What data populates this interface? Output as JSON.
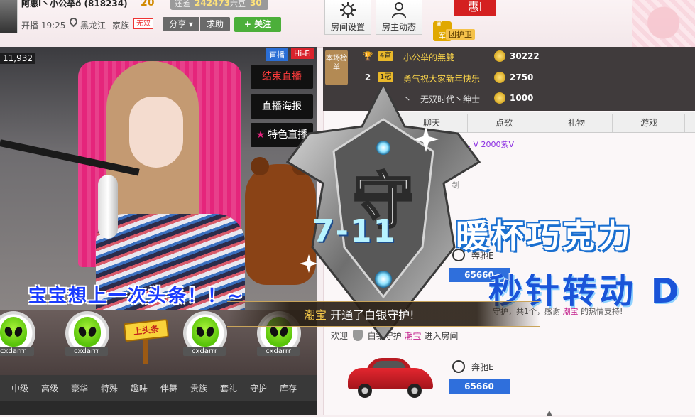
{
  "header": {
    "anchor_name": "阿惠i丶小公举ô (818234)",
    "level_value": "20",
    "diff_label": "还差",
    "diff_value": "242473",
    "bean_label": "六豆",
    "bean_level": "30",
    "live_time": "开播 19:25",
    "location": "黑龙江",
    "family_label": "家族",
    "family_value": "无双",
    "share_label": "分享",
    "help_label": "求助",
    "follow_label": "+ 关注",
    "room_settings_label": "房间设置",
    "owner_news_label": "房主动态",
    "hui_text": "惠i",
    "guard_badge": "军",
    "guard_label": "团护卫"
  },
  "video": {
    "viewer_count": "11,932",
    "live_tag": "直播",
    "hifi_tag": "Hi-Fi",
    "end_live": "结束直播",
    "poster": "直播海报",
    "special": "特色直播",
    "caption": "宝宝想上一次头条！！~"
  },
  "gifts": [
    {
      "name": "cxdarrr"
    },
    {
      "name": "cxdarrr"
    },
    {
      "name": "cxdarrr"
    },
    {
      "name": "cxdarrr"
    }
  ],
  "headline_sign": "上头条",
  "categories": [
    "中级",
    "高级",
    "豪华",
    "特殊",
    "趣味",
    "伴舞",
    "贵族",
    "套礼",
    "守护",
    "库存"
  ],
  "rank": {
    "label": "本场榜单",
    "rows": [
      {
        "num": "",
        "level": "4富",
        "name": "小公举的無雙",
        "score": "30222"
      },
      {
        "num": "2",
        "level": "1冠",
        "name": "勇气祝大家新年快乐",
        "score": "2750"
      },
      {
        "num": "",
        "level": "",
        "name": "丶一无双时代丶绅士",
        "score": "1000"
      }
    ]
  },
  "tabs": [
    "聊天",
    "点歌",
    "礼物",
    "游戏"
  ],
  "chat": {
    "vip_text": "500 ... V 2000紫V",
    "apple_text": "剑",
    "car_name_1": "奔驰E",
    "car_score_1": "65660",
    "car_name_2": "奔驰E",
    "car_score_2": "65660",
    "thanks_prefix": "守护，共1个，感谢",
    "thanks_user": "潮宝",
    "thanks_suffix": "的热情支持!",
    "welcome_prefix": "欢迎",
    "welcome_mid": "白银守护",
    "welcome_user": "潮宝",
    "welcome_suffix": "进入房间"
  },
  "promo": {
    "date": "7-11",
    "line1": "暖杯巧克力",
    "line2": "秒针转动 D"
  },
  "shield": {
    "glyph": "守"
  },
  "notice": {
    "user": "潮宝",
    "text": "开通了白银守护!"
  }
}
